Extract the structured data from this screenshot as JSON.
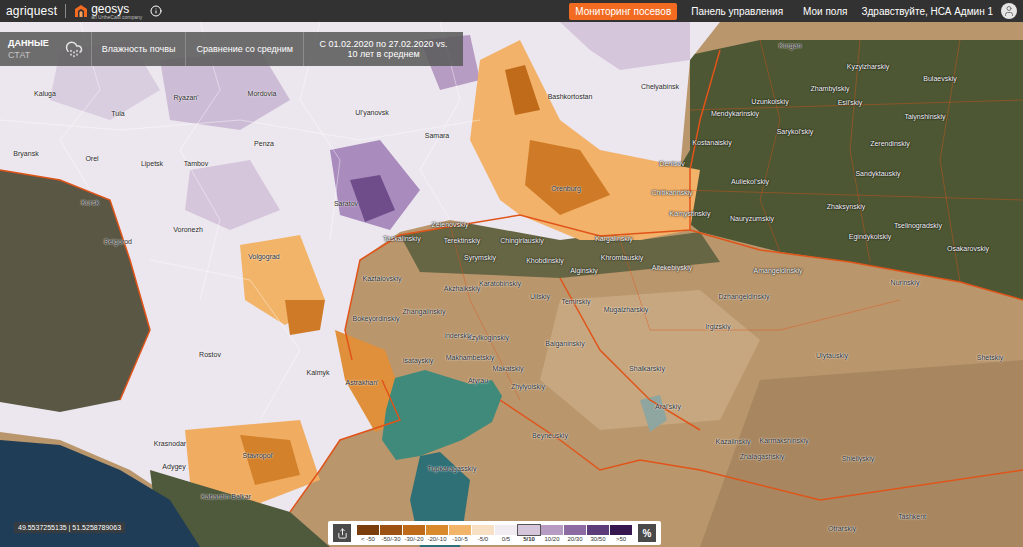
{
  "header": {
    "logo": "agriquest",
    "brand": "geosys",
    "brand_sub": "an UrtheCast company",
    "nav": [
      {
        "label": "Мониторинг посевов",
        "selected": true
      },
      {
        "label": "Панель управления",
        "selected": false
      },
      {
        "label": "Мои поля",
        "selected": false
      }
    ],
    "greeting": "Здравствуйте, НСА Админ 1"
  },
  "data_panel": {
    "tabs": [
      {
        "label": "ДАННЫЕ",
        "selected": true
      },
      {
        "label": "СТАТ",
        "selected": false
      }
    ],
    "layer": "Влажность почвы",
    "mode": "Сравнение со средним",
    "period": "С 01.02.2020 по 27.02.2020 vs. 10 лет в среднем"
  },
  "map": {
    "labels": [
      "Kaluga",
      "Tula",
      "Ryazan'",
      "Mordovia",
      "Ul'yanovsk",
      "Samara",
      "Bryansk",
      "Orel",
      "Lipetsk",
      "Tambov",
      "Penza",
      "Kursk",
      "Voronezh",
      "Saratov",
      "Belgorod",
      "Volgograd",
      "Rostov",
      "Kalmyk",
      "Astrakhan'",
      "Krasnodar",
      "Stavropol'",
      "Adygey",
      "Kabardin-Balkar",
      "Bashkortostan",
      "Orenburg",
      "Chelyabinsk",
      "Kurgan",
      "Kyzylzharskiy",
      "Zhambylskiy",
      "Bulaevskiy",
      "Uzunkolskiy",
      "Esil'skiy",
      "Mendykarinskiy",
      "Taiynshinskiy",
      "Sarykol'skiy",
      "Kostanaiskiy",
      "Zerendinskiy",
      "Denisov",
      "Auliekol'skiy",
      "Sandyktauskiy",
      "Chitikarinskiy",
      "Kamystinskiy",
      "Zhaksynskiy",
      "Nauryzumskiy",
      "Tselinogradskiy",
      "Egindykolskiy",
      "Osakarovskiy",
      "Amangeldinskiy",
      "Aitekebiyskiy",
      "Nurinskiy",
      "Kargalinskiy",
      "Khromtauskiy",
      "Alginskiy",
      "Khobdinskiy",
      "Taskalinskiy",
      "Terektinskiy",
      "Chingirlauskiy",
      "Syrymskiy",
      "Zelenovskiy",
      "Dzhangeldinskiy",
      "Temirskiy",
      "Mugalzharskiy",
      "Uilskiy",
      "Karatobinskiy",
      "Kaztalovskiy",
      "Akzhaikskiy",
      "Bokeyordinskiy",
      "Zhangalinskiy",
      "Inderskiy",
      "Kzylkoginskiy",
      "Makhambetskiy",
      "Isatayskiy",
      "Atyrau",
      "Makatskiy",
      "Zhylyoiskiy",
      "Baiganinskiy",
      "Shalkarskiy",
      "Irgizskiy",
      "Ulytauskiy",
      "Shetskiy",
      "Aral'skiy",
      "Kazalinskiy",
      "Karmakshinskiy",
      "Zhalagashskiy",
      "Shieliyskiy",
      "Beyneuskiy",
      "Tupkaragasskiy",
      "Otrarskiy",
      "Tashkent"
    ]
  },
  "coordinates": "49.5537255135 | 51.5258789063",
  "legend": {
    "items": [
      {
        "label": "< -50",
        "color": "#7a3d0c",
        "selected": false
      },
      {
        "label": "-50/-30",
        "color": "#9c5213",
        "selected": false
      },
      {
        "label": "-30/-20",
        "color": "#c06b1a",
        "selected": false
      },
      {
        "label": "-20/-10",
        "color": "#d98a2a",
        "selected": false
      },
      {
        "label": "-10/-5",
        "color": "#f2b468",
        "selected": false
      },
      {
        "label": "-5/0",
        "color": "#f7e0c4",
        "selected": false
      },
      {
        "label": "0/5",
        "color": "#f1ecf2",
        "selected": false
      },
      {
        "label": "5/10",
        "color": "#d6c6dc",
        "selected": true
      },
      {
        "label": "10/20",
        "color": "#b69bc2",
        "selected": false
      },
      {
        "label": "20/30",
        "color": "#8d6aa2",
        "selected": false
      },
      {
        "label": "30/50",
        "color": "#5d3c7a",
        "selected": false
      },
      {
        "label": ">50",
        "color": "#37174f",
        "selected": false
      }
    ],
    "unit": "%"
  }
}
